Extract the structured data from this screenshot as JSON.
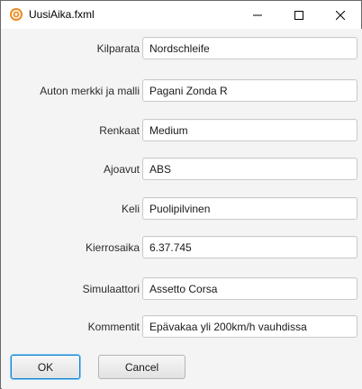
{
  "window": {
    "title": "UusiAika.fxml"
  },
  "form": {
    "fields": [
      {
        "label": "Kilparata",
        "value": "Nordschleife"
      },
      {
        "label": "Auton merkki ja malli",
        "value": "Pagani Zonda R"
      },
      {
        "label": "Renkaat",
        "value": "Medium"
      },
      {
        "label": "Ajoavut",
        "value": "ABS"
      },
      {
        "label": "Keli",
        "value": "Puolipilvinen"
      },
      {
        "label": "Kierrosaika",
        "value": "6.37.745"
      },
      {
        "label": "Simulaattori",
        "value": "Assetto Corsa"
      },
      {
        "label": "Kommentit",
        "value": "Epävakaa yli 200km/h vauhdissa"
      }
    ]
  },
  "buttons": {
    "ok_label": "OK",
    "cancel_label": "Cancel"
  },
  "colors": {
    "focus_border": "#0a84d8",
    "app_icon": "#f08a1d"
  }
}
